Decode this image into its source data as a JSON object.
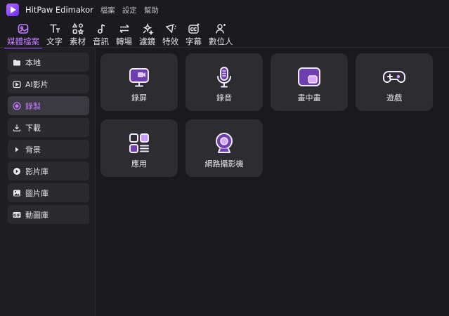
{
  "app": {
    "title": "HitPaw Edimakor",
    "menu": [
      "檔案",
      "設定",
      "幫助"
    ]
  },
  "toolbar": {
    "items": [
      {
        "label": "媒體檔案",
        "icon": "media-icon",
        "active": true
      },
      {
        "label": "文字",
        "icon": "text-icon"
      },
      {
        "label": "素材",
        "icon": "elements-icon"
      },
      {
        "label": "音訊",
        "icon": "audio-icon"
      },
      {
        "label": "轉場",
        "icon": "transition-icon"
      },
      {
        "label": "濾鏡",
        "icon": "filter-icon"
      },
      {
        "label": "特效",
        "icon": "effects-icon"
      },
      {
        "label": "字幕",
        "icon": "subtitles-icon"
      },
      {
        "label": "數位人",
        "icon": "digital-human-icon"
      }
    ]
  },
  "sidebar": {
    "items": [
      {
        "label": "本地",
        "icon": "folder-icon"
      },
      {
        "label": "AI影片",
        "icon": "ai-video-icon"
      },
      {
        "label": "錄製",
        "icon": "record-icon",
        "active": true
      },
      {
        "label": "下載",
        "icon": "download-icon"
      },
      {
        "label": "背景",
        "icon": "play-triangle-icon"
      },
      {
        "label": "影片庫",
        "icon": "video-library-icon"
      },
      {
        "label": "圖片庫",
        "icon": "image-library-icon"
      },
      {
        "label": "動圖庫",
        "icon": "gif-icon",
        "icon_text": "GIF"
      }
    ]
  },
  "main": {
    "cards": [
      {
        "label": "錄屏",
        "icon": "screen-record-icon"
      },
      {
        "label": "錄音",
        "icon": "microphone-icon"
      },
      {
        "label": "畫中畫",
        "icon": "picture-in-picture-icon"
      },
      {
        "label": "遊戲",
        "icon": "gamepad-icon"
      },
      {
        "label": "應用",
        "icon": "apps-icon"
      },
      {
        "label": "網路攝影機",
        "icon": "webcam-icon"
      }
    ]
  },
  "colors": {
    "accent": "#a35cff",
    "accent_text": "#c07bff",
    "background": "#1b1b1f",
    "card": "#2c2c31"
  }
}
